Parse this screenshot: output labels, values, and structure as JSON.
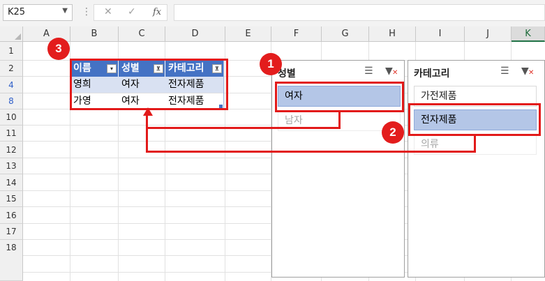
{
  "formula_bar": {
    "name_box": "K25",
    "name_box_arrow": "▼",
    "separator": "⋮",
    "cancel_symbol": "✕",
    "enter_symbol": "✓",
    "fx_label": "fx",
    "formula_value": ""
  },
  "columns": [
    "A",
    "B",
    "C",
    "D",
    "E",
    "F",
    "G",
    "H",
    "I",
    "J",
    "K"
  ],
  "rows": [
    "1",
    "2",
    "4",
    "8",
    "10",
    "11",
    "12",
    "13",
    "14",
    "15",
    "16",
    "17",
    "18"
  ],
  "table": {
    "headers": [
      "이름",
      "성별",
      "카테고리"
    ],
    "rows": [
      [
        "영희",
        "여자",
        "전자제품"
      ],
      [
        "가영",
        "여자",
        "전자제품"
      ]
    ]
  },
  "slicers": [
    {
      "title": "성별",
      "items": [
        {
          "label": "여자",
          "state": "selected"
        },
        {
          "label": "남자",
          "state": "no-data"
        }
      ]
    },
    {
      "title": "카테고리",
      "items": [
        {
          "label": "가전제품",
          "state": "available"
        },
        {
          "label": "전자제품",
          "state": "selected"
        },
        {
          "label": "의류",
          "state": "no-data"
        }
      ]
    }
  ],
  "badges": [
    "1",
    "2",
    "3"
  ],
  "colors": {
    "table_header": "#4472c4",
    "table_band": "#d9e1f2",
    "slicer_selected": "#b4c6e7",
    "annotation_red": "#e21a1a",
    "filtered_row_number": "#2f5fc9"
  }
}
